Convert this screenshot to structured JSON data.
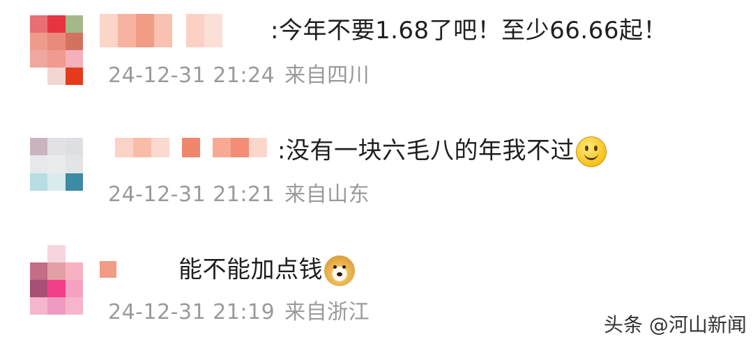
{
  "comments": [
    {
      "text": ":今年不要1.68了吧！至少66.66起！",
      "date": "24-12-31 21:24",
      "location": "来自四川",
      "avatar_colors": [
        "#e86f73",
        "#e8343e",
        "#a3b98a",
        "#ee9b8b",
        "#e88a7c",
        "#d2735f",
        "#f0a7a0",
        "#f29a91",
        "#f4b1bb",
        "#ffffff",
        "#f2d6d1",
        "#e53a1c"
      ],
      "name_colors": [
        "#fbd5c8",
        "#f7b39f",
        "#f39c85",
        "#f8c1b0",
        "#ffffff",
        "#fbd1c6",
        "#fbe0d8"
      ]
    },
    {
      "text": ":没有一块六毛八的年我不过",
      "emoji": "smile-emoji",
      "date": "24-12-31 21:21",
      "location": "来自山东",
      "avatar_colors": [
        "#c9b3bf",
        "#e2e2e4",
        "#dedfe2",
        "#e6e8ec",
        "#e9ebed",
        "#e2e5e8",
        "#b7dde2",
        "#d7eceb",
        "#3d8ba4"
      ],
      "name_colors": [
        "#fbd2c6",
        "#f9bca9",
        "#fbd9ce",
        "#ffffff",
        "#f0876c",
        "#ffffff",
        "#f7a994",
        "#f38d78",
        "#fbd6cb"
      ]
    },
    {
      "text": "能不能加点钱",
      "emoji": "doge-emoji",
      "date": "24-12-31 21:19",
      "location": "来自浙江",
      "avatar_colors": [
        "#ffffff",
        "#f6d5dc",
        "#ffffff",
        "#c46d86",
        "#e2a0a6",
        "#f9b0c2",
        "#a74f74",
        "#f13f8a",
        "#f7a1c2",
        "#f5b5cd",
        "#ee9cc1",
        "#f7b4cd"
      ],
      "name_colors": [
        "#f29b85"
      ]
    }
  ],
  "watermark": "头条 @河山新闻"
}
